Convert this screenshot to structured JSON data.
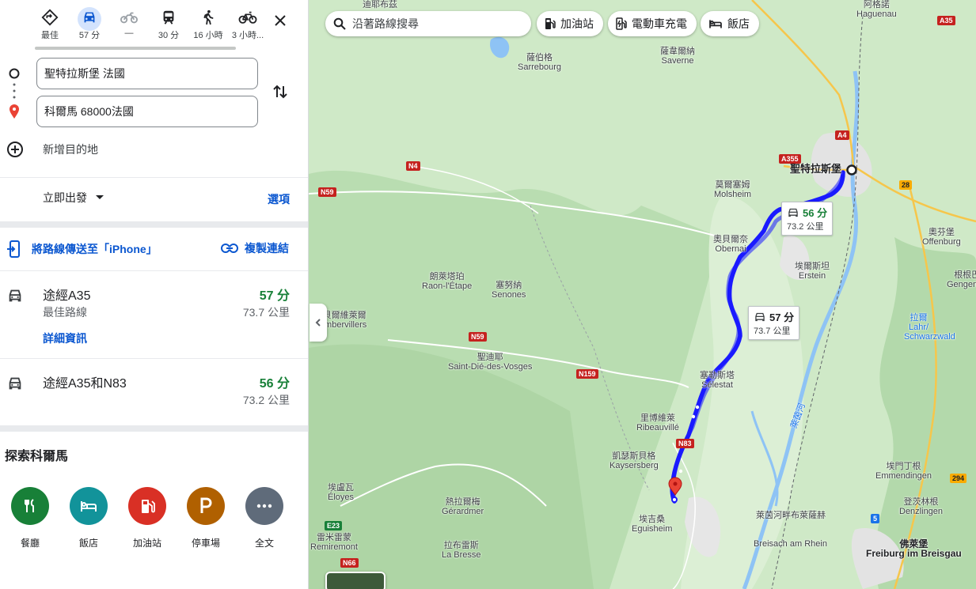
{
  "modes": [
    {
      "name": "best",
      "label": "最佳"
    },
    {
      "name": "drive",
      "label": "57 分"
    },
    {
      "name": "motorcycle",
      "label": "—"
    },
    {
      "name": "transit",
      "label": "30 分"
    },
    {
      "name": "walk",
      "label": "16 小時"
    },
    {
      "name": "bike",
      "label": "3 小時..."
    }
  ],
  "origin": {
    "value": "聖特拉斯堡 法國"
  },
  "destination": {
    "value": "科爾馬 68000法國"
  },
  "add_destination": "新增目的地",
  "depart": "立即出發",
  "options": "選項",
  "send_to_phone": "將路線傳送至「iPhone」",
  "copy_link": "複製連結",
  "routes": [
    {
      "name": "途經A35",
      "sub": "最佳路線",
      "duration": "57 分",
      "distance": "73.7 公里",
      "details": "詳細資訊"
    },
    {
      "name": "途經A35和N83",
      "duration": "56 分",
      "distance": "73.2 公里"
    }
  ],
  "explore": {
    "title": "探索科爾馬",
    "categories": [
      {
        "label": "餐廳",
        "color": "#188038"
      },
      {
        "label": "飯店",
        "color": "#12939a"
      },
      {
        "label": "加油站",
        "color": "#d93025"
      },
      {
        "label": "停車場",
        "color": "#b06000"
      },
      {
        "label": "全文",
        "color": "#5f6b7a"
      }
    ]
  },
  "map": {
    "search_placeholder": "沿著路線搜尋",
    "chips": [
      "加油站",
      "電動車充電",
      "飯店"
    ],
    "route_color": "#1a1aff",
    "callouts": [
      {
        "duration": "56 分",
        "distance": "73.2 公里"
      },
      {
        "duration": "57 分",
        "distance": "73.7 公里"
      }
    ],
    "places": [
      {
        "zh": "迪耶布茲",
        "fr": ""
      },
      {
        "zh": "阿格諾",
        "fr": "Haguenau"
      },
      {
        "zh": "薩伯格",
        "fr": "Sarrebourg"
      },
      {
        "zh": "薩韋爾納",
        "fr": "Saverne"
      },
      {
        "zh": "聖特拉斯堡",
        "fr": ""
      },
      {
        "zh": "莫爾塞姆",
        "fr": "Molsheim"
      },
      {
        "zh": "奧貝爾奈",
        "fr": "Obernai"
      },
      {
        "zh": "埃爾斯坦",
        "fr": "Erstein"
      },
      {
        "zh": "奧芬堡",
        "fr": "Offenburg"
      },
      {
        "zh": "根根巴",
        "fr": "Gengenba"
      },
      {
        "zh": "朗萊塔珀",
        "fr": "Raon-l'Étape"
      },
      {
        "zh": "塞努納",
        "fr": "Senones"
      },
      {
        "zh": "朗貝爾維萊爾",
        "fr": "Rambervillers"
      },
      {
        "zh": "聖迪耶",
        "fr": "Saint-Dié-des-Vosges"
      },
      {
        "zh": "塞勒斯塔",
        "fr": "Sélestat"
      },
      {
        "zh": "里博維萊",
        "fr": "Ribeauvillé"
      },
      {
        "zh": "凱瑟斯貝格",
        "fr": "Kaysersberg"
      },
      {
        "zh": "埃門丁根",
        "fr": "Emmendingen"
      },
      {
        "zh": "埃盧瓦",
        "fr": "Éloyes"
      },
      {
        "zh": "熱拉爾梅",
        "fr": "Gérardmer"
      },
      {
        "zh": "埃吉桑",
        "fr": "Eguisheim"
      },
      {
        "zh": "萊茵河畔布萊薩赫",
        "fr": "Breisach am Rhein"
      },
      {
        "zh": "登茨林根",
        "fr": "Denzlingen"
      },
      {
        "zh": "雷米雷蒙",
        "fr": "Remiremont"
      },
      {
        "zh": "拉布雷斯",
        "fr": "La Bresse"
      },
      {
        "zh": "佛萊堡",
        "fr": "Freiburg im Breisgau"
      },
      {
        "zh": "拉爾",
        "fr": "Lahr/"
      },
      {
        "zh": "",
        "fr": "Schwarzwald"
      },
      {
        "zh": "萊茵河",
        "fr": ""
      }
    ],
    "shields": [
      "A35",
      "A4",
      "A355",
      "N4",
      "N59",
      "28",
      "N59",
      "N159",
      "N83",
      "E23",
      "N66",
      "294",
      "5"
    ]
  }
}
